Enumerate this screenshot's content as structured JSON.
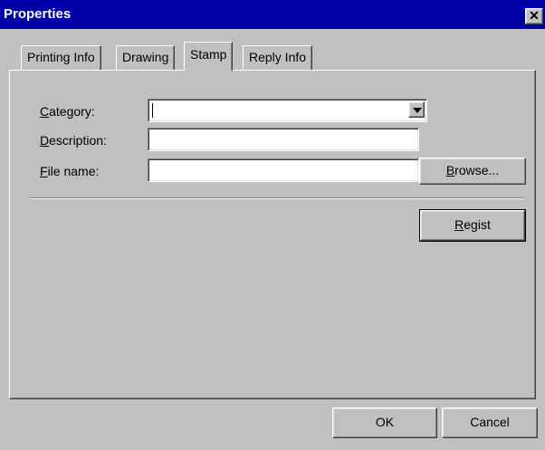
{
  "window": {
    "title": "Properties",
    "close_glyph": "✕"
  },
  "tabs": [
    {
      "label": "Printing Info"
    },
    {
      "label": "Drawing"
    },
    {
      "label": "Stamp",
      "active": true
    },
    {
      "label": "Reply Info"
    }
  ],
  "form": {
    "category": {
      "label_mnemonic": "C",
      "label_rest": "ategory:",
      "value": ""
    },
    "description": {
      "label_mnemonic": "D",
      "label_rest": "escription:",
      "value": ""
    },
    "file_name": {
      "label_mnemonic": "F",
      "label_rest": "ile name:",
      "value": ""
    },
    "browse": {
      "mnemonic": "B",
      "rest": "rowse..."
    },
    "regist": {
      "mnemonic": "R",
      "rest": "egist"
    }
  },
  "footer": {
    "ok_label": "OK",
    "cancel_label": "Cancel"
  },
  "colors": {
    "titlebar": "#0000a8",
    "face": "#c0c0c0"
  }
}
